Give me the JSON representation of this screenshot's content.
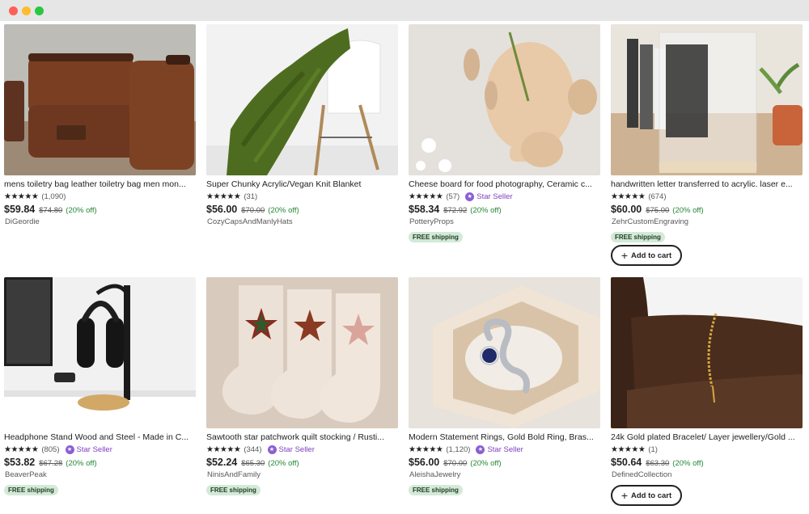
{
  "window": {
    "controls": [
      "close",
      "minimize",
      "maximize"
    ]
  },
  "star_glyphs": "★★★★★",
  "star_seller_label": "Star Seller",
  "free_shipping_label": "FREE shipping",
  "add_to_cart_label": "Add to cart",
  "listings": [
    {
      "title": "mens toiletry bag leather toiletry bag men mon...",
      "rating": 5,
      "reviews": "(1,090)",
      "star_seller": false,
      "price": "$59.84",
      "original_price": "$74.80",
      "discount": "(20% off)",
      "shop": "DiGeordie",
      "free_shipping": false,
      "add_to_cart": false,
      "image": "leather-toiletry-bags"
    },
    {
      "title": "Super Chunky Acrylic/Vegan Knit Blanket",
      "rating": 5,
      "reviews": "(31)",
      "star_seller": false,
      "price": "$56.00",
      "original_price": "$70.00",
      "discount": "(20% off)",
      "shop": "CozyCapsAndManlyHats",
      "free_shipping": false,
      "add_to_cart": false,
      "image": "green-chunky-knit-blanket"
    },
    {
      "title": "Cheese board for food photography, Ceramic c...",
      "rating": 5,
      "reviews": "(57)",
      "star_seller": true,
      "price": "$58.34",
      "original_price": "$72.92",
      "discount": "(20% off)",
      "shop": "PotteryProps",
      "free_shipping": true,
      "add_to_cart": false,
      "image": "ceramic-cheese-board"
    },
    {
      "title": "handwritten letter transferred to acrylic. laser e...",
      "rating": 5,
      "reviews": "(674)",
      "star_seller": false,
      "price": "$60.00",
      "original_price": "$75.00",
      "discount": "(20% off)",
      "shop": "ZehrCustomEngraving",
      "free_shipping": true,
      "add_to_cart": true,
      "image": "acrylic-letter-plaque"
    },
    {
      "title": "Headphone Stand Wood and Steel - Made in C...",
      "rating": 5,
      "reviews": "(805)",
      "star_seller": true,
      "price": "$53.82",
      "original_price": "$67.28",
      "discount": "(20% off)",
      "shop": "BeaverPeak",
      "free_shipping": true,
      "add_to_cart": false,
      "image": "headphone-stand"
    },
    {
      "title": "Sawtooth star patchwork quilt stocking / Rusti...",
      "rating": 5,
      "reviews": "(344)",
      "star_seller": true,
      "price": "$52.24",
      "original_price": "$65.30",
      "discount": "(20% off)",
      "shop": "NinisAndFamily",
      "free_shipping": true,
      "add_to_cart": false,
      "image": "quilted-stockings"
    },
    {
      "title": "Modern Statement Rings, Gold Bold Ring, Bras...",
      "rating": 5,
      "reviews": "(1,120)",
      "star_seller": true,
      "price": "$56.00",
      "original_price": "$70.00",
      "discount": "(20% off)",
      "shop": "AleishaJewelry",
      "free_shipping": true,
      "add_to_cart": false,
      "image": "statement-ring-in-box"
    },
    {
      "title": "24k Gold plated Bracelet/ Layer jewellery/Gold ...",
      "rating": 5,
      "reviews": "(1)",
      "star_seller": false,
      "price": "$50.64",
      "original_price": "$63.30",
      "discount": "(20% off)",
      "shop": "DefinedCollection",
      "free_shipping": false,
      "add_to_cart": true,
      "image": "gold-bracelet-on-wrist"
    }
  ]
}
